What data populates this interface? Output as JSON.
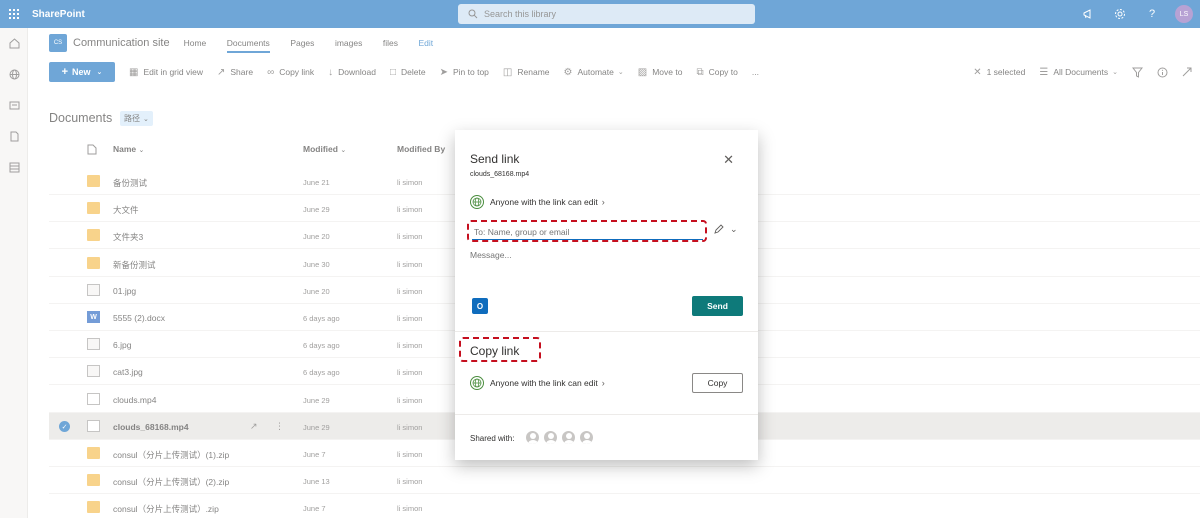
{
  "suite": {
    "brand": "SharePoint",
    "search_placeholder": "Search this library",
    "icons": [
      "megaphone-icon",
      "gear-icon",
      "help-icon",
      "avatar-initials"
    ],
    "avatar_initials": "LS"
  },
  "site": {
    "logo_text": "CS",
    "title": "Communication site",
    "nav": [
      "Home",
      "Documents",
      "Pages",
      "images",
      "files",
      "Edit"
    ],
    "active_nav": "Documents"
  },
  "commands": {
    "new_label": "New",
    "items": [
      "Edit in grid view",
      "Share",
      "Copy link",
      "Download",
      "Delete",
      "Pin to top",
      "Rename",
      "Automate",
      "Move to",
      "Copy to",
      "..."
    ],
    "selected_count": "1 selected",
    "view_label": "All Documents"
  },
  "library": {
    "title": "Documents",
    "view_badge": "路径",
    "columns": {
      "name": "Name",
      "modified": "Modified",
      "modified_by": "Modified By"
    },
    "rows": [
      {
        "name": "备份测试",
        "modified": "June 21",
        "by": "li simon",
        "type": "folder"
      },
      {
        "name": "大文件",
        "modified": "June 29",
        "by": "li simon",
        "type": "folder"
      },
      {
        "name": "文件夹3",
        "modified": "June 20",
        "by": "li simon",
        "type": "folder"
      },
      {
        "name": "新备份测试",
        "modified": "June 30",
        "by": "li simon",
        "type": "folder"
      },
      {
        "name": "01.jpg",
        "modified": "June 20",
        "by": "li simon",
        "type": "image"
      },
      {
        "name": "5555 (2).docx",
        "modified": "6 days ago",
        "by": "li simon",
        "type": "word"
      },
      {
        "name": "6.jpg",
        "modified": "6 days ago",
        "by": "li simon",
        "type": "image"
      },
      {
        "name": "cat3.jpg",
        "modified": "6 days ago",
        "by": "li simon",
        "type": "image"
      },
      {
        "name": "clouds.mp4",
        "modified": "June 29",
        "by": "li simon",
        "type": "video"
      },
      {
        "name": "clouds_68168.mp4",
        "modified": "June 29",
        "by": "li simon",
        "type": "video",
        "selected": true
      },
      {
        "name": "consul（分片上传测试）(1).zip",
        "modified": "June 7",
        "by": "li simon",
        "type": "zip"
      },
      {
        "name": "consul（分片上传测试）(2).zip",
        "modified": "June 13",
        "by": "li simon",
        "type": "zip"
      },
      {
        "name": "consul（分片上传测试）.zip",
        "modified": "June 7",
        "by": "li simon",
        "type": "zip"
      }
    ]
  },
  "dialog": {
    "title": "Send link",
    "filename": "clouds_68168.mp4",
    "permission": "Anyone with the link can edit",
    "to_placeholder": "To: Name, group or email",
    "message_placeholder": "Message...",
    "outlook_letter": "O",
    "send_label": "Send",
    "copy_title": "Copy link",
    "copy_permission": "Anyone with the link can edit",
    "copy_label": "Copy",
    "shared_with_label": "Shared with:",
    "shared_count": 4,
    "highlight_color": "#c50f1f"
  },
  "colors": {
    "suite": "#0f6cbd",
    "send": "#0e7a7a"
  }
}
